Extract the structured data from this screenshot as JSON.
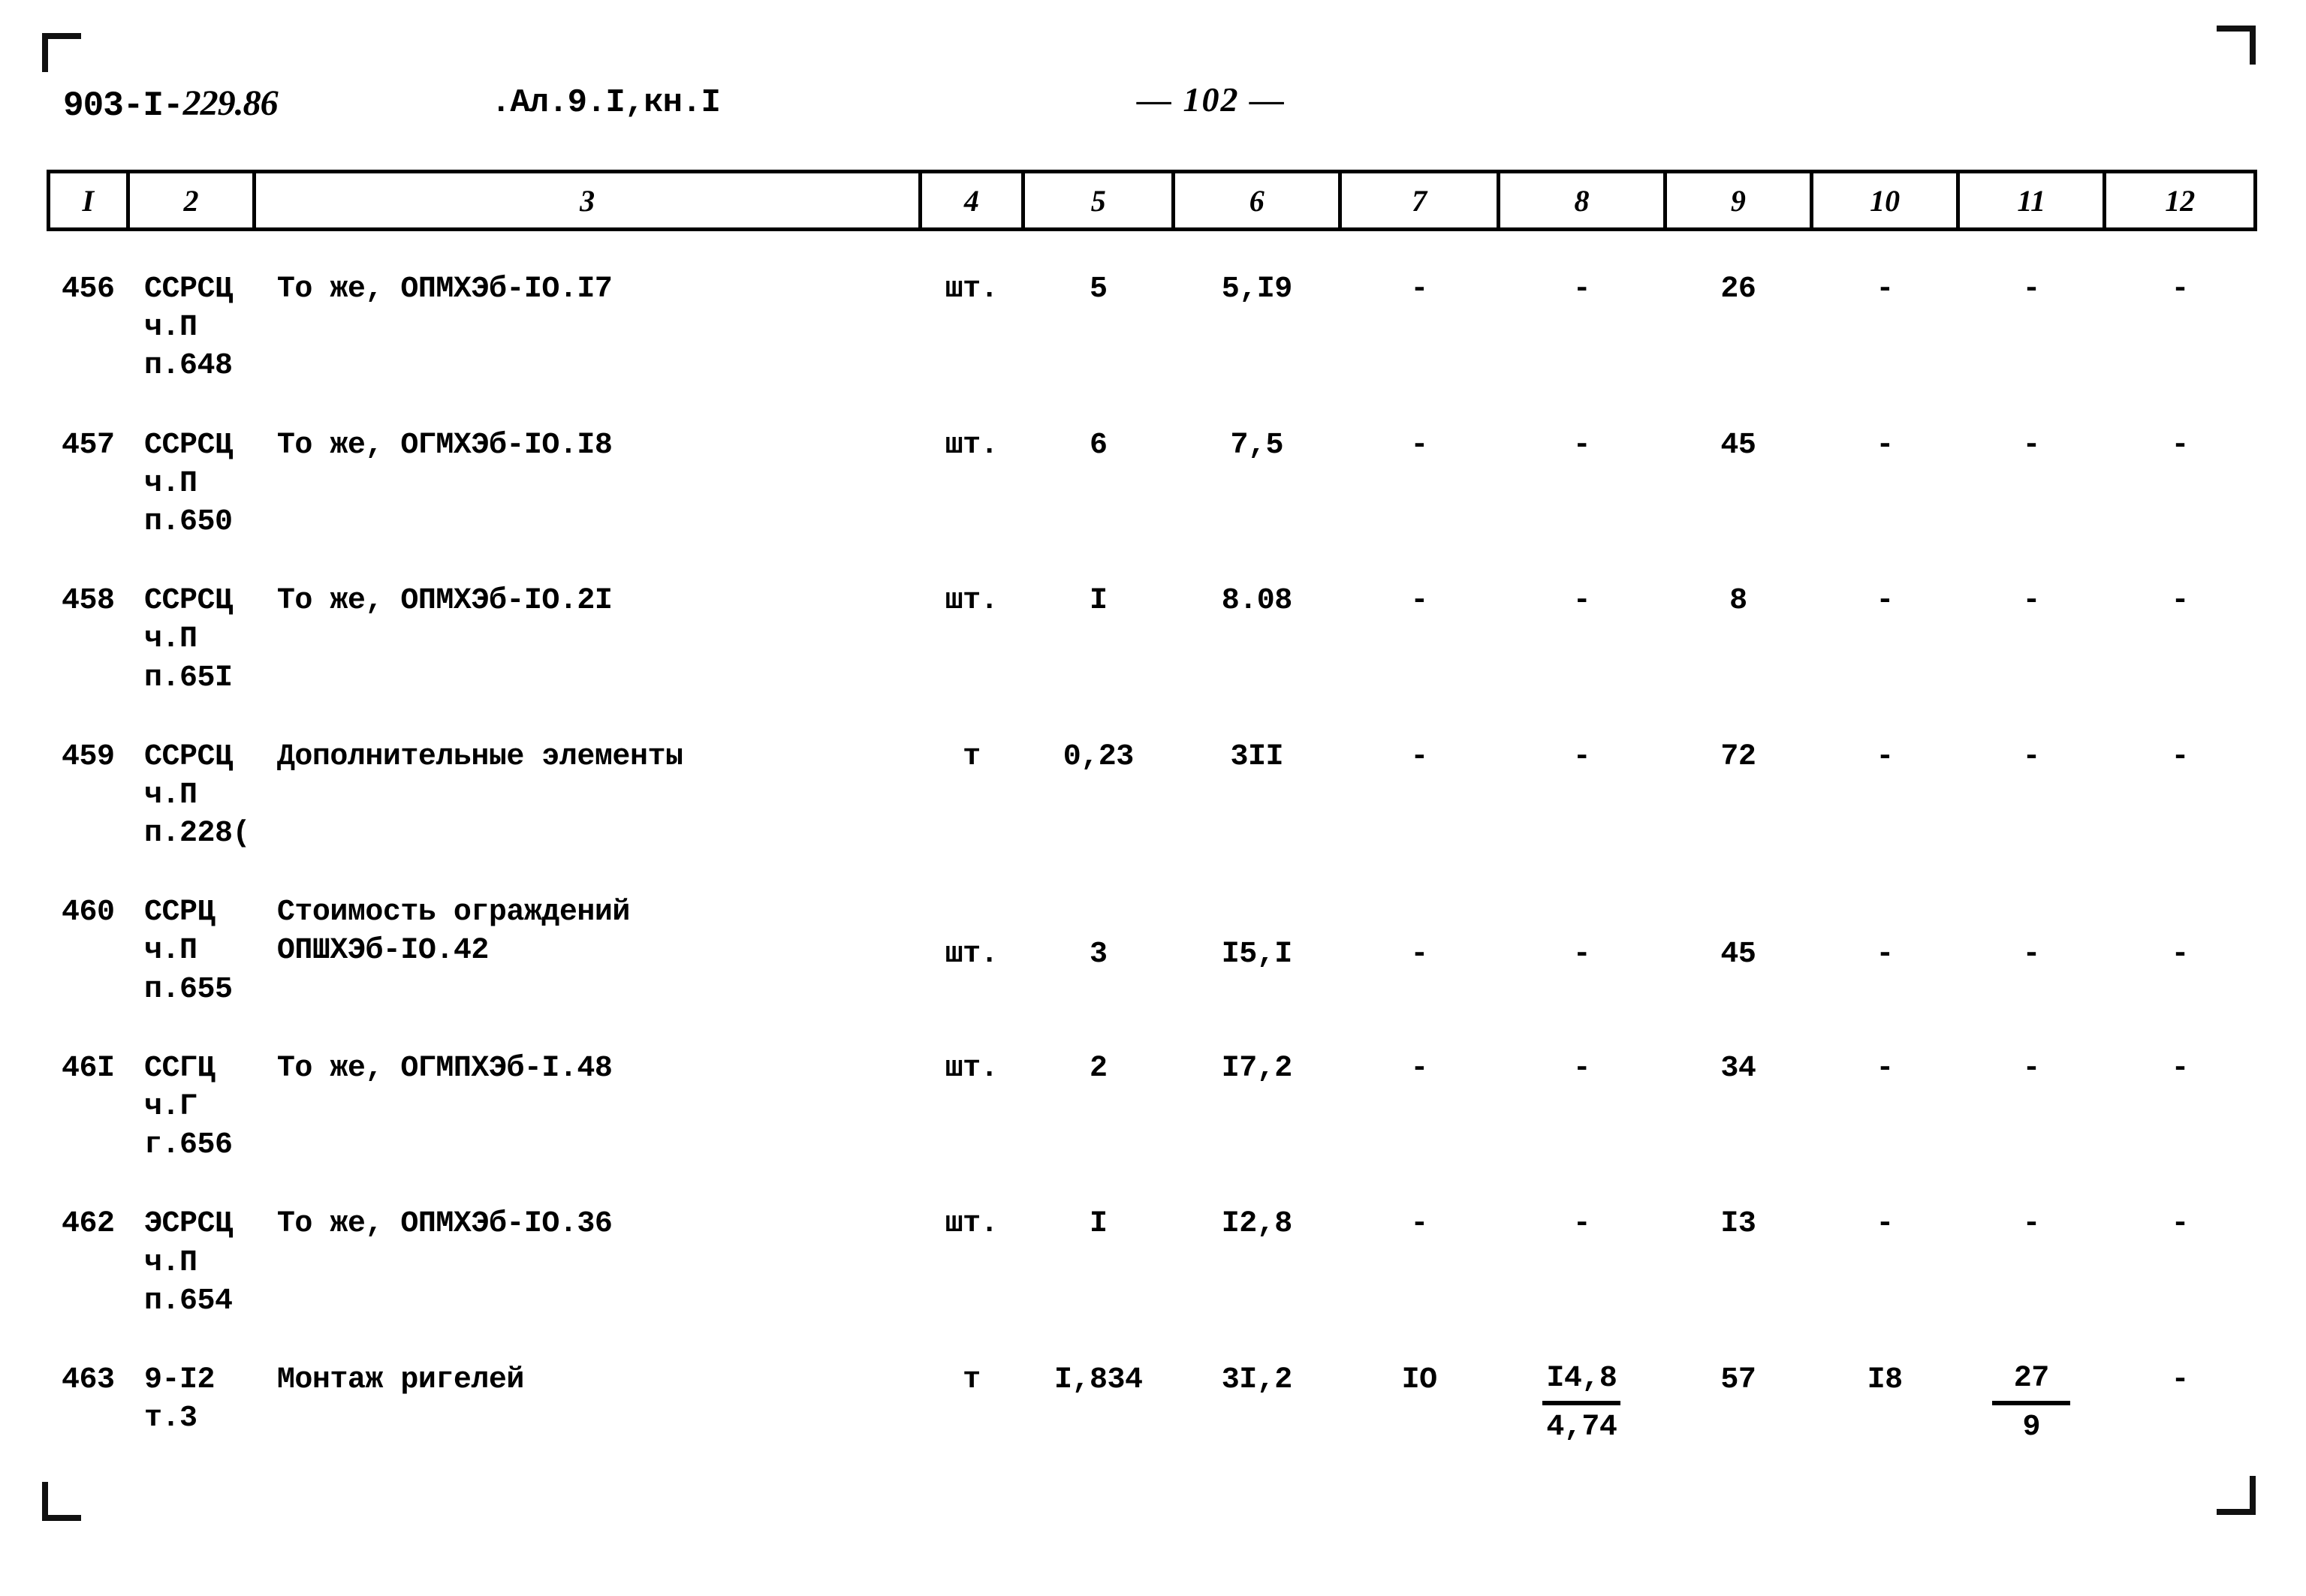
{
  "document": {
    "code": "903-I-229.86",
    "code_prefix": "903-I-",
    "code_italic": "229.86",
    "album": ".Ал.9.I,кн.I",
    "page_number": "— 102 —"
  },
  "table": {
    "column_headers": [
      "I",
      "2",
      "3",
      "4",
      "5",
      "6",
      "7",
      "8",
      "9",
      "10",
      "11",
      "12"
    ],
    "rows": [
      {
        "num": "456",
        "code": "ССРСЦ\nч.П\nп.648",
        "description": "То же, ОПМХЭб-IO.I7",
        "unit": "шт.",
        "c5": "5",
        "c6": "5,I9",
        "c7": "-",
        "c8": "-",
        "c9": "26",
        "c10": "-",
        "c11": "-",
        "c12": "-"
      },
      {
        "num": "457",
        "code": "ССРСЦ\nч.П\nп.650",
        "description": "То же, ОГМХЭб-IO.I8",
        "unit": "шт.",
        "c5": "6",
        "c6": "7,5",
        "c7": "-",
        "c8": "-",
        "c9": "45",
        "c10": "-",
        "c11": "-",
        "c12": "-"
      },
      {
        "num": "458",
        "code": "ССРСЦ\nч.П\nп.65I",
        "description": "То же, ОПМХЭб-IO.2I",
        "unit": "шт.",
        "c5": "I",
        "c6": "8.08",
        "c7": "-",
        "c8": "-",
        "c9": "8",
        "c10": "-",
        "c11": "-",
        "c12": "-"
      },
      {
        "num": "459",
        "code": "ССРСЦ\nч.П\nп.228(",
        "description": "Дополнительные элементы",
        "unit": "т",
        "c5": "0,23",
        "c6": "3II",
        "c7": "-",
        "c8": "-",
        "c9": "72",
        "c10": "-",
        "c11": "-",
        "c12": "-"
      },
      {
        "num": "460",
        "code": "ССРЦ\nч.П\nп.655",
        "description": "Стоимость ограждений\nОПШХЭб-IO.42",
        "unit": "шт.",
        "c5": "3",
        "c6": "I5,I",
        "c7": "-",
        "c8": "-",
        "c9": "45",
        "c10": "-",
        "c11": "-",
        "c12": "-",
        "two_line_desc": true
      },
      {
        "num": "46I",
        "code": "ССГЦ\nч.Г\nг.656",
        "description": "То же, ОГМПХЭб-I.48",
        "unit": "шт.",
        "c5": "2",
        "c6": "I7,2",
        "c7": "-",
        "c8": "-",
        "c9": "34",
        "c10": "-",
        "c11": "-",
        "c12": "-"
      },
      {
        "num": "462",
        "code": "ЭСРСЦ\nч.П\nп.654",
        "description": "То же, ОПМХЭб-IO.36",
        "unit": "шт.",
        "c5": "I",
        "c6": "I2,8",
        "c7": "-",
        "c8": "-",
        "c9": "I3",
        "c10": "-",
        "c11": "-",
        "c12": "-"
      },
      {
        "num": "463",
        "code": "9-I2\nт.3",
        "description": "Монтаж ригелей",
        "unit": "т",
        "c5": "I,834",
        "c6": "3I,2",
        "c7": "IO",
        "c8_fraction": {
          "numerator": "I4,8",
          "denominator": "4,74"
        },
        "c9": "57",
        "c10": "I8",
        "c11_fraction": {
          "numerator": "27",
          "denominator": "9"
        },
        "c12": "-"
      }
    ]
  }
}
